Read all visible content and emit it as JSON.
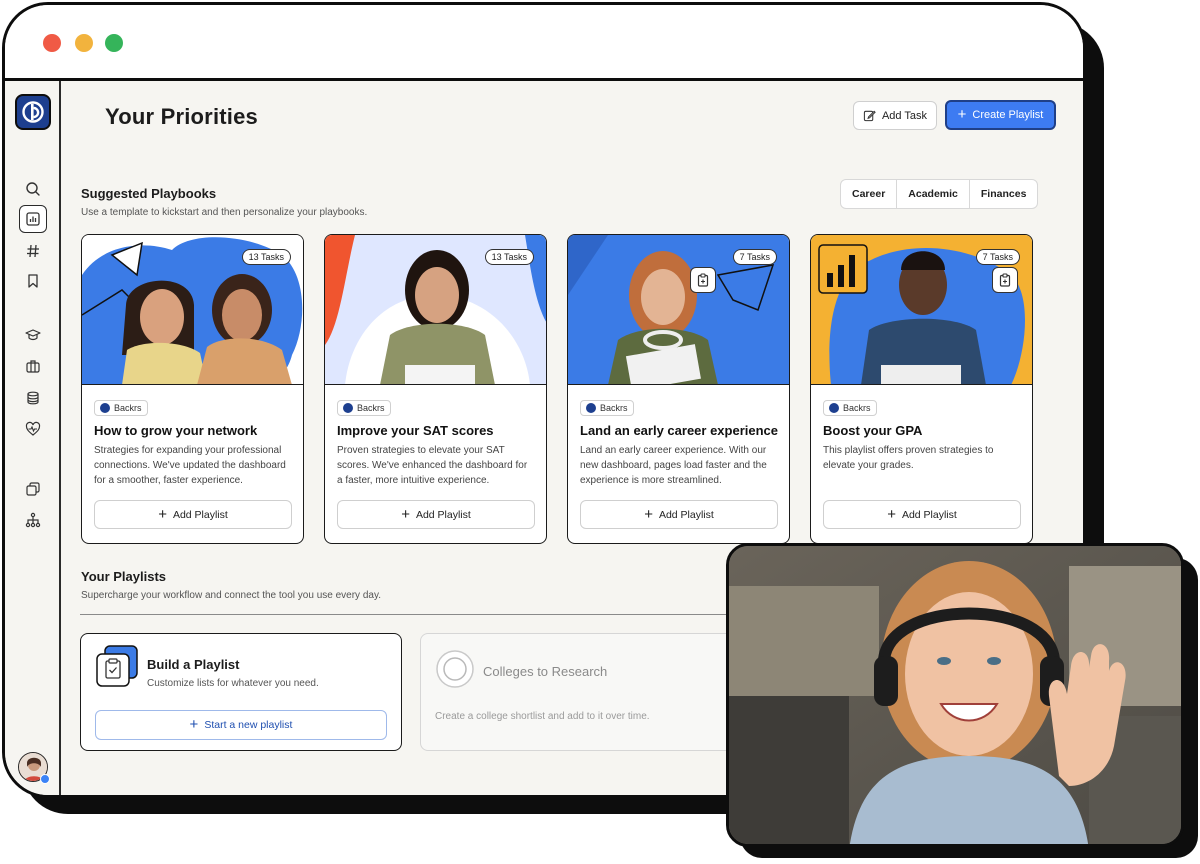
{
  "header": {
    "title": "Your Priorities",
    "add_task_label": "Add Task",
    "create_playlist_label": "Create Playlist"
  },
  "colors": {
    "accent": "#3d7bf2",
    "logo": "#1d3f8f",
    "background": "#f6f5f1",
    "close": "#f05a45",
    "minimize": "#f2b33d",
    "maximize": "#35b45a"
  },
  "sidebar": {
    "icons": [
      "logo-icon",
      "search-icon",
      "dashboard-icon",
      "hashtag-icon",
      "bookmark-icon",
      "graduation-cap-icon",
      "briefcase-icon",
      "coins-icon",
      "heart-pulse-icon",
      "layers-icon",
      "org-chart-icon"
    ],
    "active": "dashboard-icon"
  },
  "suggested": {
    "title": "Suggested Playbooks",
    "subtitle": "Use a template to kickstart and then personalize your playbooks.",
    "filters": [
      "Career",
      "Academic",
      "Finances"
    ],
    "cards": [
      {
        "tasks": "13 Tasks",
        "brand": "Backrs",
        "title": "How to grow your network",
        "description": "Strategies for expanding your professional connections. We've updated the dashboard for a smoother, faster experience.",
        "button": "Add Playlist"
      },
      {
        "tasks": "13 Tasks",
        "brand": "Backrs",
        "title": "Improve your SAT scores",
        "description": "Proven strategies to elevate your SAT scores. We've enhanced the dashboard for a faster, more intuitive experience.",
        "button": "Add Playlist"
      },
      {
        "tasks": "7 Tasks",
        "brand": "Backrs",
        "title": "Land an early career experience",
        "description": "Land an early career experience. With our new dashboard, pages load faster and the experience is more streamlined.",
        "button": "Add Playlist"
      },
      {
        "tasks": "7 Tasks",
        "brand": "Backrs",
        "title": "Boost your GPA",
        "description": "This playlist offers proven strategies to elevate your grades.",
        "button": "Add Playlist"
      }
    ]
  },
  "playlists": {
    "title": "Your Playlists",
    "subtitle": "Supercharge your workflow and connect the tool you use every day.",
    "build": {
      "title": "Build a Playlist",
      "subtitle": "Customize lists for whatever you need.",
      "button": "Start a new playlist"
    },
    "college": {
      "title": "Colleges to Research",
      "subtitle": "Create a college shortlist and add to it over time."
    }
  }
}
